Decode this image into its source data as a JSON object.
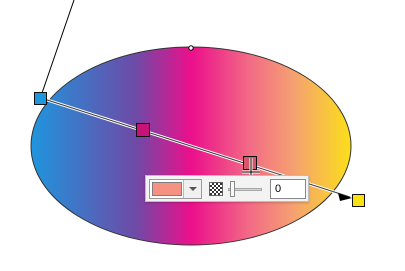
{
  "gradient": {
    "colors": {
      "start": "#1e96de",
      "mid_purple": "#6e4aa6",
      "mid_magenta": "#ec0f8b",
      "mid_pink": "#f26a86",
      "light_salmon": "#f5a171",
      "end": "#fce017"
    }
  },
  "handles": {
    "start_handle_color": "#1e96de",
    "mid_handle_color": "#c9117a",
    "active_handle_color": "#d4576a",
    "end_handle_color": "#f7e20f"
  },
  "stop_editor": {
    "selected_color": "#f59282",
    "transparency_icon": "checkerboard-icon",
    "transparency_value": "0"
  },
  "icons": {
    "end_arrow": "arrow-head-icon",
    "cursor": "move-cursor-icon"
  }
}
